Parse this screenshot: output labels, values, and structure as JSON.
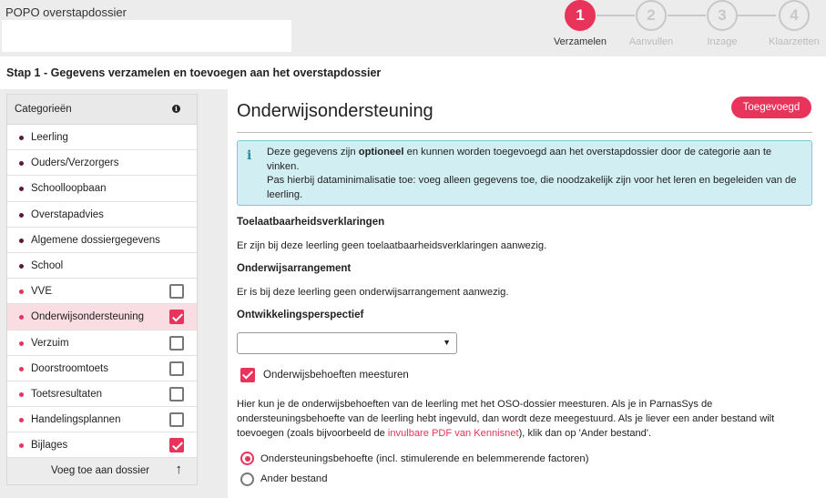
{
  "app": {
    "title": "POPO overstapdossier"
  },
  "steps": [
    {
      "number": "1",
      "label": "Verzamelen",
      "active": true
    },
    {
      "number": "2",
      "label": "Aanvullen",
      "active": false
    },
    {
      "number": "3",
      "label": "Inzage",
      "active": false
    },
    {
      "number": "4",
      "label": "Klaarzetten",
      "active": false
    }
  ],
  "step_heading": "Stap 1 - Gegevens verzamelen en toevoegen aan het overstapdossier",
  "sidebar": {
    "header": "Categorieën",
    "info_icon": "i",
    "items": [
      {
        "label": "Leerling",
        "dot_color": "#5c1940",
        "checkbox": false,
        "checked": false,
        "selected": false
      },
      {
        "label": "Ouders/Verzorgers",
        "dot_color": "#5c1940",
        "checkbox": false,
        "checked": false,
        "selected": false
      },
      {
        "label": "Schoolloopbaan",
        "dot_color": "#5c1940",
        "checkbox": false,
        "checked": false,
        "selected": false
      },
      {
        "label": "Overstapadvies",
        "dot_color": "#5c1940",
        "checkbox": false,
        "checked": false,
        "selected": false
      },
      {
        "label": "Algemene dossiergegevens",
        "dot_color": "#5c1940",
        "checkbox": false,
        "checked": false,
        "selected": false
      },
      {
        "label": "School",
        "dot_color": "#5c1940",
        "checkbox": false,
        "checked": false,
        "selected": false
      },
      {
        "label": "VVE",
        "dot_color": "#e8335a",
        "checkbox": true,
        "checked": false,
        "selected": false
      },
      {
        "label": "Onderwijsondersteuning",
        "dot_color": "#e8335a",
        "checkbox": true,
        "checked": true,
        "selected": true
      },
      {
        "label": "Verzuim",
        "dot_color": "#e8335a",
        "checkbox": true,
        "checked": false,
        "selected": false
      },
      {
        "label": "Doorstroomtoets",
        "dot_color": "#e8335a",
        "checkbox": true,
        "checked": false,
        "selected": false
      },
      {
        "label": "Toetsresultaten",
        "dot_color": "#e8335a",
        "checkbox": true,
        "checked": false,
        "selected": false
      },
      {
        "label": "Handelingsplannen",
        "dot_color": "#e8335a",
        "checkbox": true,
        "checked": false,
        "selected": false
      },
      {
        "label": "Bijlages",
        "dot_color": "#e8335a",
        "checkbox": true,
        "checked": true,
        "selected": false
      }
    ],
    "footer_label": "Voeg toe aan dossier",
    "footer_icon": "arrow-up-icon"
  },
  "main": {
    "title": "Onderwijsondersteuning",
    "added_button": "Toegevoegd",
    "info": {
      "icon": "i",
      "pre": "Deze gegevens zijn ",
      "bold": "optioneel",
      "post": " en kunnen worden toegevoegd aan het overstapdossier door de categorie aan te vinken.",
      "line2": "Pas hierbij dataminimalisatie toe: voeg alleen gegevens toe, die noodzakelijk zijn voor het leren en begeleiden van de leerling."
    },
    "sections": [
      {
        "title": "Toelaatbaarheidsverklaringen",
        "text": "Er zijn bij deze leerling geen toelaatbaarheidsverklaringen aanwezig."
      },
      {
        "title": "Onderwijsarrangement",
        "text": "Er is bij deze leerling geen onderwijsarrangement aanwezig."
      }
    ],
    "ontwikkelingsperspectief_title": "Ontwikkelingsperspectief",
    "select_value": "",
    "send_needs_checkbox": {
      "label": "Onderwijsbehoeften meesturen",
      "checked": true
    },
    "paragraph": {
      "pre": "Hier kun je de onderwijsbehoeften van de leerling met het OSO-dossier meesturen. Als je in ParnasSys de ondersteuningsbehoefte van de leerling hebt ingevuld, dan wordt deze meegestuurd. Als je liever een ander bestand wilt toevoegen (zoals bijvoorbeeld de ",
      "link": "invulbare PDF van Kennisnet",
      "post": "), klik dan op 'Ander bestand'."
    },
    "radios": [
      {
        "label": "Ondersteuningsbehoefte (incl. stimulerende en belemmerende factoren)",
        "selected": true
      },
      {
        "label": "Ander bestand",
        "selected": false
      }
    ]
  },
  "colors": {
    "accent": "#e8335a",
    "dark_dot": "#5c1940",
    "info_bg": "#d1eef2"
  }
}
